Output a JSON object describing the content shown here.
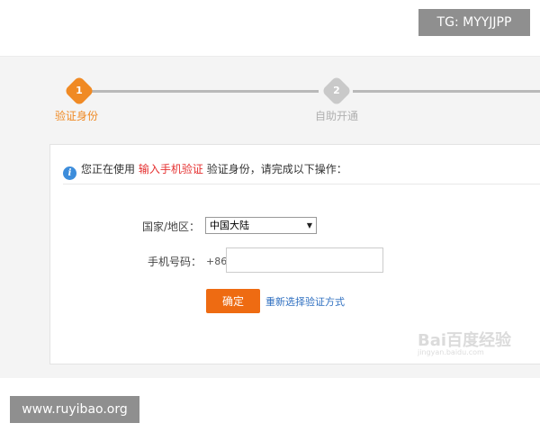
{
  "watermark_top": "TG: MYYJJPP",
  "watermark_bottom": "www.ruyibao.org",
  "steps": [
    {
      "number": "1",
      "label": "验证身份",
      "state": "active"
    },
    {
      "number": "2",
      "label": "自助开通",
      "state": "pending"
    }
  ],
  "notice": {
    "prefix": "您正在使用",
    "highlight": "输入手机验证",
    "suffix": "验证身份，请完成以下操作："
  },
  "form": {
    "region_label": "国家/地区：",
    "region_value": "中国大陆",
    "phone_label": "手机号码：",
    "phone_prefix": "+86",
    "phone_value": "",
    "confirm_label": "确定",
    "reselect_link": "重新选择验证方式"
  },
  "baidu_watermark": {
    "brand": "Bai百度经验",
    "sub": "jingyan.baidu.com"
  },
  "colors": {
    "accent_orange": "#ee6b12",
    "step_active": "#f08a24",
    "step_pending": "#c9c9c9",
    "link_blue": "#2f6fc0",
    "highlight_red": "#e53030",
    "info_blue": "#3d8ddb"
  }
}
